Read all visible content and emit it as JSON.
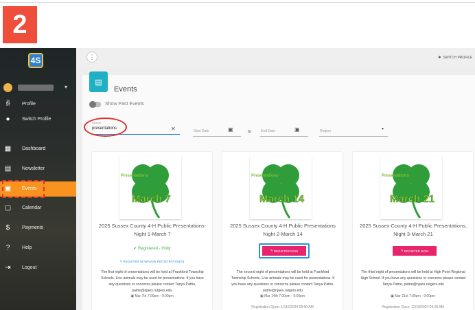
{
  "step_badge": "2",
  "sidebar": {
    "logo": "4S",
    "items": [
      {
        "label": "Profile",
        "icon": "person-walk-icon"
      },
      {
        "label": "Switch Profile",
        "icon": "person-icon"
      },
      {
        "label": "Dashboard",
        "icon": "dashboard-icon"
      },
      {
        "label": "Newsletter",
        "icon": "newsletter-icon"
      },
      {
        "label": "Events",
        "icon": "calendar-icon"
      },
      {
        "label": "Calendar",
        "icon": "calendar-icon"
      },
      {
        "label": "Payments",
        "icon": "dollar-icon"
      },
      {
        "label": "Help",
        "icon": "help-icon"
      },
      {
        "label": "Logout",
        "icon": "logout-icon"
      }
    ]
  },
  "topbar": {
    "switch_profile": "SWITCH PROFILE"
  },
  "page": {
    "title": "Events",
    "toggle_label": "Show Past Events"
  },
  "filters": {
    "search_label": "Search",
    "search_value": "presentations",
    "start_date": "Start Date",
    "to": "to",
    "end_date": "End Date",
    "region": "Region"
  },
  "cards": [
    {
      "clover_text": "March 7",
      "clover_sub": "Presentations",
      "title": "2025 Sussex County 4-H Public Presentations-Night 1-March 7",
      "status": "Registered - Holly",
      "link": "REGISTER NOW/VIEW REGISTRATION(S)",
      "description": "The first night of presentations will be held at Frankford Township Schools. Live animals may be used for presentations. If you have any questions or concerns please contact Tanya Patrie, patrie@njaes.rutgers.edu.",
      "date": "Mar 7th 7:00pm - 9:00pm"
    },
    {
      "clover_text": "March 14",
      "clover_sub": "Presentations",
      "title": "2025 Sussex County 4-H Public Presentations Night 2-March 14",
      "button": "REGISTER NOW",
      "description": "The second night of presentations will be held at Frankford Township Schools. Live animals may be used for presentations. If you have any questions or concerns please contact Tanya Patrie, patrie@njaes.rutgers.edu",
      "date": "Mar 14th 7:00pm - 9:00pm",
      "reg_open": "Registration Open: 12/16/2024 09:00 AM"
    },
    {
      "clover_text": "March 21",
      "clover_sub": "Presentations",
      "title": "2025 Sussex County 4-H Public Presentations, Night 3-March 21",
      "button": "REGISTER NOW",
      "description": "The third night of presentations will be held at High Point Regional High School. If you have any questions or concerns please contact Tanya Patrie, patrie@njaes.rutgers.edu",
      "date": "Mar 21st 7:00pm - 9:00pm",
      "reg_open": "Registration Open: 12/16/2024 09:00 AM"
    }
  ],
  "colors": {
    "accent_orange": "#f7931e",
    "teal": "#1fb0c4",
    "pink": "#e8246c",
    "annotation_red": "#d9332f",
    "annotation_blue": "#2d8fd9"
  }
}
